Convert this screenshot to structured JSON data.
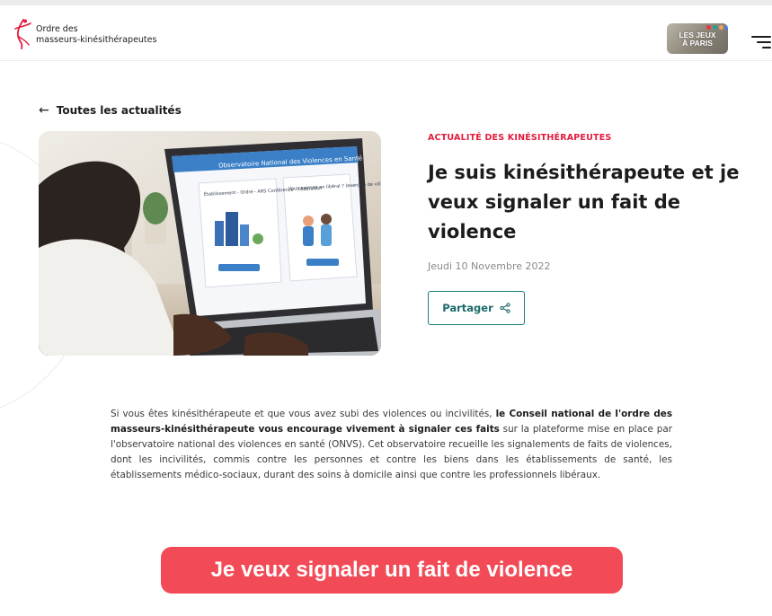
{
  "header": {
    "logo_line1": "Ordre des",
    "logo_line2": "masseurs-kinésithérapeutes",
    "jeux_line1": "LES JEUX",
    "jeux_line2": "À PARIS"
  },
  "nav": {
    "back_label": "Toutes les actualités"
  },
  "article": {
    "category": "ACTUALITÉ DES KINÉSITHÉRAPEUTES",
    "title": "Je suis kinésithérapeute et je veux signaler un fait de violence",
    "date": "Jeudi 10 Novembre 2022",
    "share_label": "Partager",
    "image": {
      "screen_title": "Observatoire National des Violences en Santé",
      "card1_text": "Établissement - Ordre - ARS Conférence - Fédération",
      "card2_text": "Vous exercez en libéral ? (exercice de ville)"
    },
    "body_part1": "Si vous êtes kinésithérapeute et que vous avez subi des violences ou incivilités, ",
    "body_bold": "le Conseil national de l'ordre des masseurs-kinésithérapeute vous encourage vivement à signaler ces faits",
    "body_part2": " sur la plateforme mise en place par l'observatoire national des violences en santé (ONVS). Cet observatoire recueille les signalements de faits de violences, dont les incivilités, commis contre les personnes et contre les biens dans les établissements de santé, les établissements médico-sociaux, durant des soins à domicile ainsi que contre les professionnels libéraux."
  },
  "cta": {
    "label": "Je veux signaler un fait de violence"
  },
  "colors": {
    "accent_red": "#e31b3d",
    "cta_red": "#f24b57",
    "teal": "#1b7d7a"
  }
}
